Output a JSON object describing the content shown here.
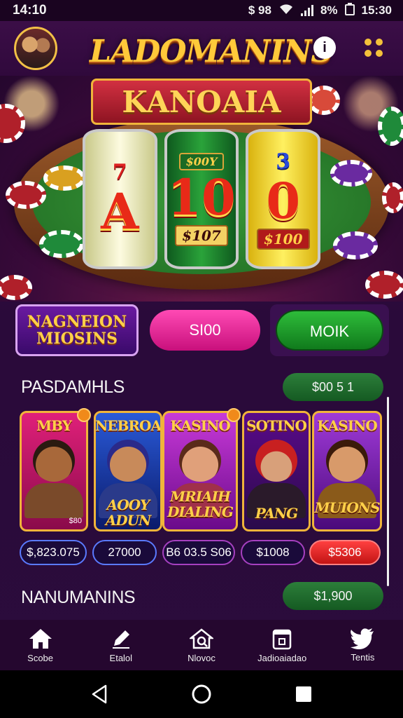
{
  "status_bar": {
    "time": "14:10",
    "battery": "8%",
    "clock_right": "15:30",
    "left_icons": "$ 98"
  },
  "header": {
    "logo": "LADOMANINS",
    "info_label": "i"
  },
  "hero": {
    "banner": "KANOAIA",
    "reel1_top": "7",
    "reel1_main": "A",
    "reel2_top": "$00Y",
    "reel2_main": "10",
    "reel2_bottom": "$107",
    "reel3_top": "3",
    "reel3_main": "0",
    "reel3_bottom": "$100"
  },
  "actions": {
    "promo_button": "NAGNEION MIOSINS",
    "pink_button": "SI00",
    "green_button": "MOIK"
  },
  "section1": {
    "title": "PASDAMHLS",
    "pill": "$00 5 1"
  },
  "cards": [
    {
      "title": "MBY",
      "caption": "",
      "corner": "$80"
    },
    {
      "title": "NEBROA",
      "caption": "AOOY ADUN",
      "corner": ""
    },
    {
      "title": "KASINO",
      "caption": "MRIAIH DIALING",
      "corner": ""
    },
    {
      "title": "SOTINO",
      "caption": "PANG",
      "corner": ""
    },
    {
      "title": "KASINO",
      "caption": "MUIONS",
      "corner": ""
    }
  ],
  "prices": [
    "$,823.075",
    "27000",
    "B6 03.5 S06",
    "$1008",
    "$5306"
  ],
  "section2": {
    "title": "NANUMANINS",
    "pill": "$1,900"
  },
  "bottom_nav": [
    "Scobe",
    "Etalol",
    "Nlovoc",
    "Jadioaiadao",
    "Tentis"
  ],
  "colors": {
    "accent_gold": "#ffc93a",
    "background": "#2a0a3a",
    "green": "#1f8a2c",
    "pink": "#e8289a"
  }
}
